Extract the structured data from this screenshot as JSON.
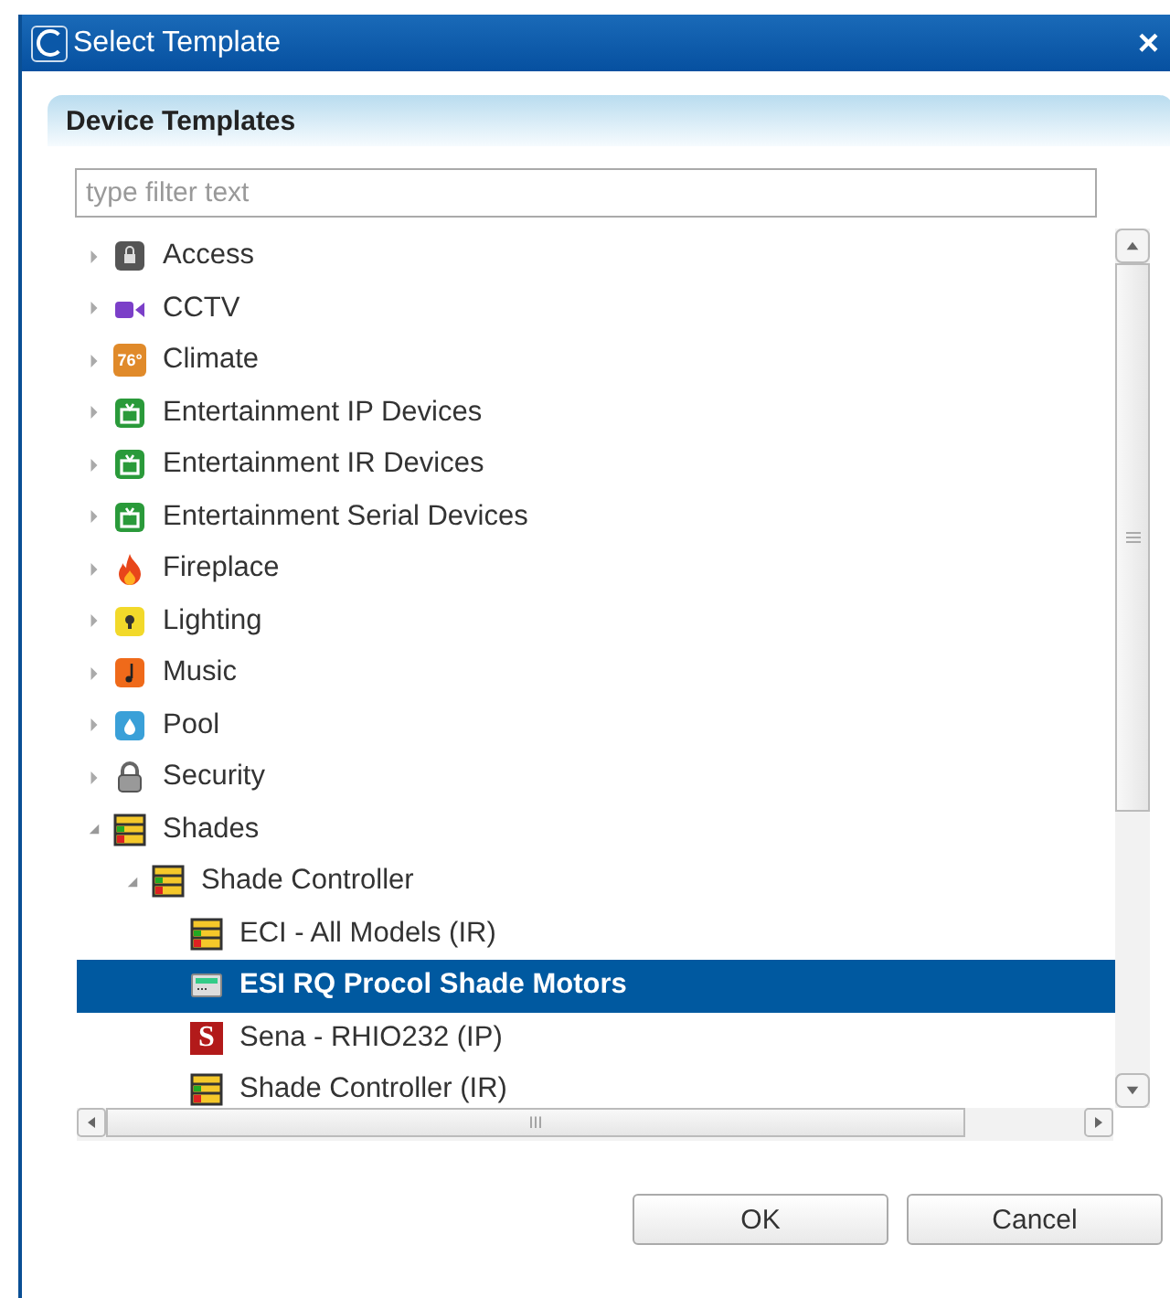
{
  "window": {
    "title": "Select Template",
    "close": "×"
  },
  "panel": {
    "title": "Device Templates"
  },
  "filter": {
    "placeholder": "type filter text"
  },
  "tree": [
    {
      "label": "Access",
      "kind": "access",
      "expanded": false,
      "selected": false
    },
    {
      "label": "CCTV",
      "kind": "cctv",
      "expanded": false,
      "selected": false
    },
    {
      "label": "Climate",
      "kind": "climate",
      "badge": "76°",
      "expanded": false,
      "selected": false
    },
    {
      "label": "Entertainment IP Devices",
      "kind": "entertainment",
      "expanded": false,
      "selected": false
    },
    {
      "label": "Entertainment IR Devices",
      "kind": "entertainment",
      "expanded": false,
      "selected": false
    },
    {
      "label": "Entertainment Serial Devices",
      "kind": "entertainment",
      "expanded": false,
      "selected": false
    },
    {
      "label": "Fireplace",
      "kind": "fireplace",
      "expanded": false,
      "selected": false
    },
    {
      "label": "Lighting",
      "kind": "lighting",
      "expanded": false,
      "selected": false
    },
    {
      "label": "Music",
      "kind": "music",
      "expanded": false,
      "selected": false
    },
    {
      "label": "Pool",
      "kind": "pool",
      "expanded": false,
      "selected": false
    },
    {
      "label": "Security",
      "kind": "security",
      "expanded": false,
      "selected": false
    },
    {
      "label": "Shades",
      "kind": "shades",
      "expanded": true,
      "selected": false,
      "children": [
        {
          "label": "Shade Controller",
          "kind": "shades",
          "expanded": true,
          "selected": false,
          "children": [
            {
              "label": "ECI - All Models (IR)",
              "kind": "shades",
              "selected": false
            },
            {
              "label": "ESI RQ Procol Shade Motors",
              "kind": "module",
              "selected": true
            },
            {
              "label": "Sena - RHIO232 (IP)",
              "kind": "brand",
              "letter": "S",
              "selected": false
            },
            {
              "label": "Shade Controller (IR)",
              "kind": "shades",
              "selected": false
            }
          ]
        }
      ]
    }
  ],
  "scroll_text": "III",
  "buttons": [
    {
      "label": "OK"
    },
    {
      "label": "Cancel"
    }
  ]
}
